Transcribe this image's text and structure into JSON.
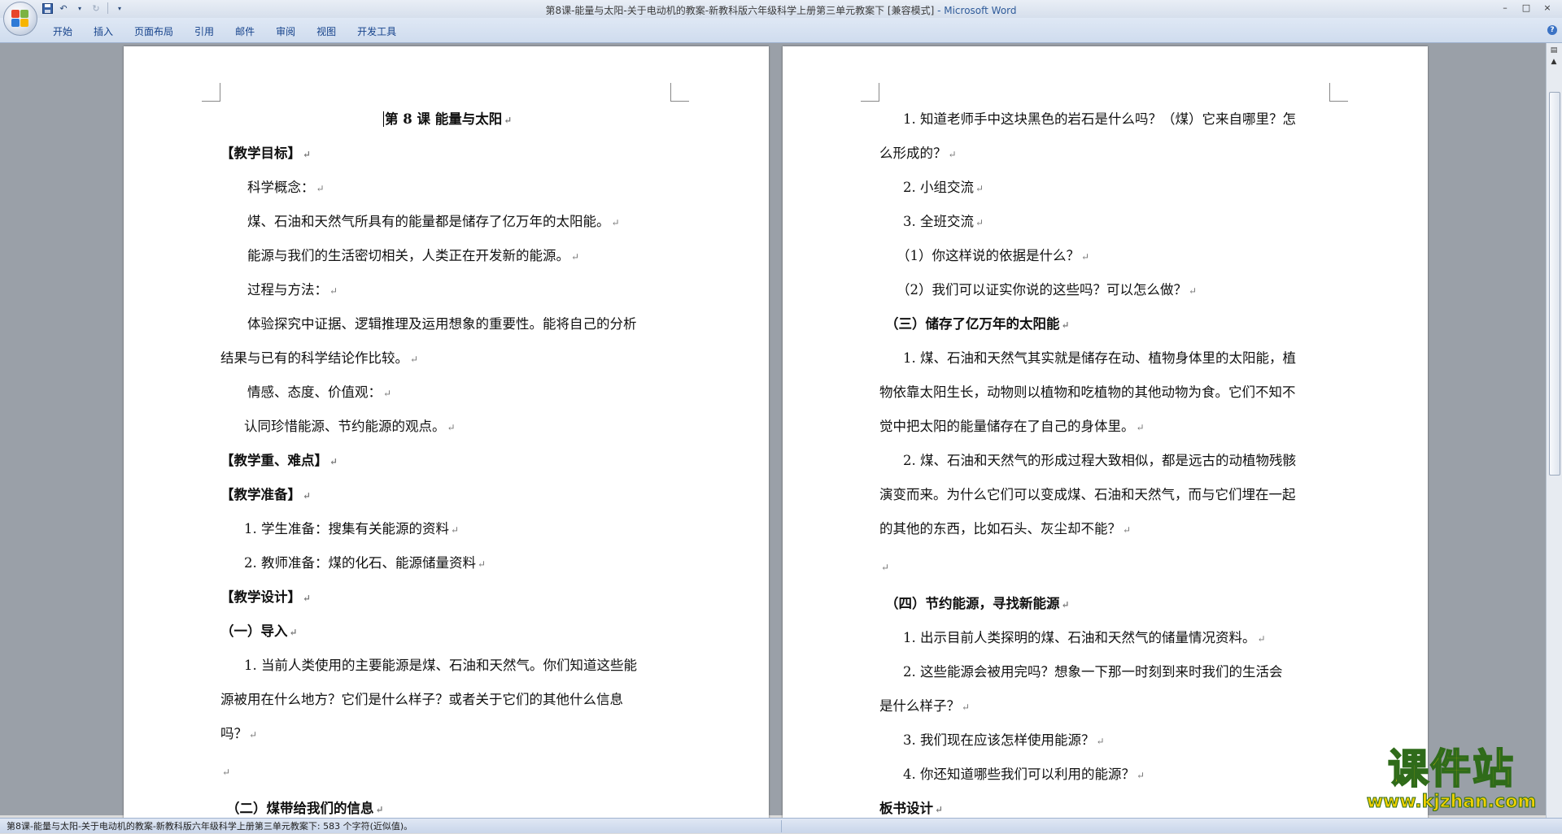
{
  "window": {
    "title": "第8课-能量与太阳-关于电动机的教案-新教科版六年级科学上册第三单元教案下 [兼容模式]",
    "app_name": " - Microsoft Word",
    "minimize": "–",
    "maximize": "□",
    "close": "×"
  },
  "ribbon": {
    "tabs": [
      "开始",
      "插入",
      "页面布局",
      "引用",
      "邮件",
      "审阅",
      "视图",
      "开发工具"
    ]
  },
  "left_page": {
    "title": "第 8 课 能量与太阳",
    "lines": [
      "【教学目标】",
      "科学概念：",
      "煤、石油和天然气所具有的能量都是储存了亿万年的太阳能。",
      "能源与我们的生活密切相关，人类正在开发新的能源。",
      "过程与方法：",
      "体验探究中证据、逻辑推理及运用想象的重要性。能将自己的分析",
      "结果与已有的科学结论作比较。",
      "情感、态度、价值观：",
      "认同珍惜能源、节约能源的观点。",
      "【教学重、难点】",
      "【教学准备】",
      "1.  学生准备：搜集有关能源的资料",
      "2.  教师准备：煤的化石、能源储量资料",
      "【教学设计】",
      "（一）导入",
      "1.  当前人类使用的主要能源是煤、石油和天然气。你们知道这些能",
      "源被用在什么地方？它们是什么样子？或者关于它们的其他什么信息",
      "吗？",
      "",
      "（二）煤带给我们的信息"
    ]
  },
  "right_page": {
    "lines": [
      "1.  知道老师手中这块黑色的岩石是什么吗？（煤）它来自哪里？怎",
      "么形成的？",
      "2.  小组交流",
      "3.  全班交流",
      "（1）你这样说的依据是什么？",
      "（2）我们可以证实你说的这些吗？可以怎么做？",
      "（三）储存了亿万年的太阳能",
      "1.  煤、石油和天然气其实就是储存在动、植物身体里的太阳能，植",
      "物依靠太阳生长，动物则以植物和吃植物的其他动物为食。它们不知不",
      "觉中把太阳的能量储存在了自己的身体里。",
      "2.  煤、石油和天然气的形成过程大致相似，都是远古的动植物残骸",
      "演变而来。为什么它们可以变成煤、石油和天然气，而与它们埋在一起",
      "的其他的东西，比如石头、灰尘却不能？",
      "",
      "（四）节约能源，寻找新能源",
      "1.  出示目前人类探明的煤、石油和天然气的储量情况资料。",
      "2.  这些能源会被用完吗？想象一下那一时刻到来时我们的生活会",
      "是什么样子？",
      "3.  我们现在应该怎样使用能源？",
      "4.  你还知道哪些我们可以利用的能源？",
      "板书设计"
    ]
  },
  "status": {
    "text": "第8课-能量与太阳-关于电动机的教案-新教科版六年级科学上册第三单元教案下: 583 个字符(近似值)。"
  },
  "watermark": {
    "main": "课件站",
    "url": "www.kjzhan.com"
  },
  "marks": {
    "paragraph": "↵"
  }
}
